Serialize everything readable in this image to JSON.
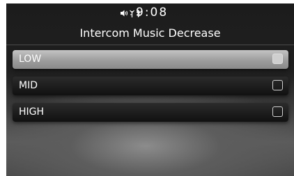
{
  "status_bar": {
    "icons": [
      "speaker-volume-icon",
      "antenna-icon",
      "bluetooth-icon"
    ],
    "time": "9:08"
  },
  "screen": {
    "title": "Intercom Music Decrease"
  },
  "options": [
    {
      "label": "LOW",
      "selected": true
    },
    {
      "label": "MID",
      "selected": false
    },
    {
      "label": "HIGH",
      "selected": false
    }
  ],
  "colors": {
    "highlight": "#b0b0b0",
    "text": "#ffffff",
    "background": "#1c1c1c"
  }
}
